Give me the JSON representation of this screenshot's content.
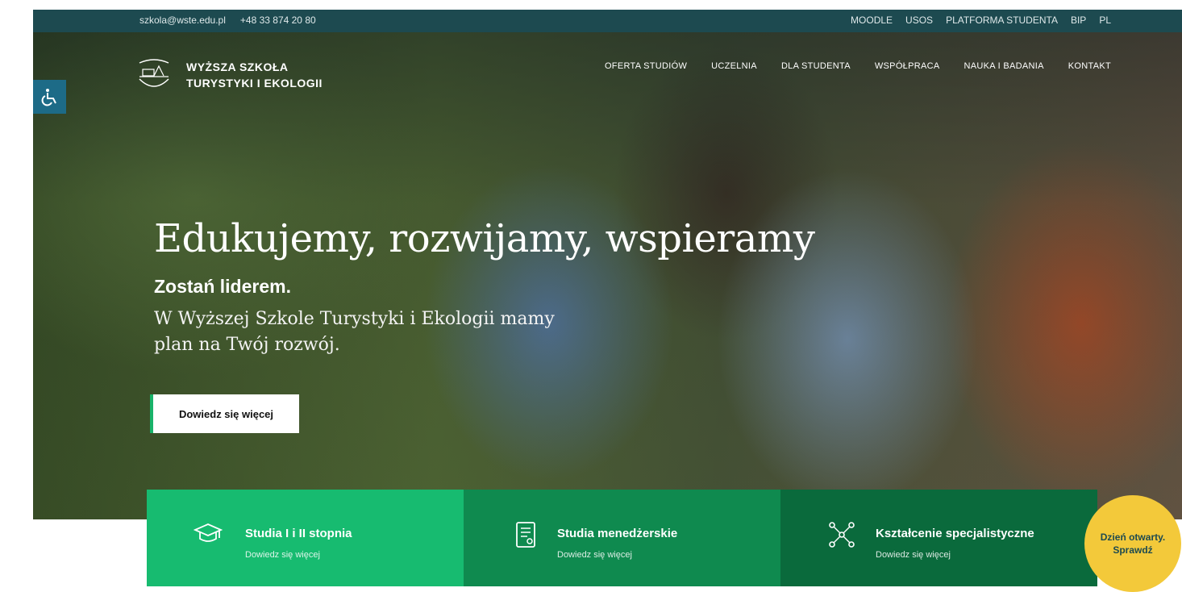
{
  "topbar": {
    "email": "szkola@wste.edu.pl",
    "phone": "+48 33 874 20 80",
    "links": [
      "MOODLE",
      "USOS",
      "PLATFORMA STUDENTA",
      "BIP",
      "PL"
    ]
  },
  "logo": {
    "line1": "WYŻSZA SZKOŁA",
    "line2": "TURYSTYKI I EKOLOGII"
  },
  "nav": [
    "OFERTA STUDIÓW",
    "UCZELNIA",
    "DLA STUDENTA",
    "WSPÓŁPRACA",
    "NAUKA I BADANIA",
    "KONTAKT"
  ],
  "hero": {
    "headline": "Edukujemy, rozwijamy, wspieramy",
    "subhead": "Zostań liderem.",
    "lead_line1": "W Wyższej Szkole Turystyki i Ekologii mamy",
    "lead_line2": "plan na Twój rozwój.",
    "cta": "Dowiedz się więcej"
  },
  "cards": [
    {
      "title": "Studia I i II stopnia",
      "sub": "Dowiedz się więcej",
      "icon": "graduation-cap-icon"
    },
    {
      "title": "Studia menedżerskie",
      "sub": "Dowiedz się więcej",
      "icon": "certificate-icon"
    },
    {
      "title": "Kształcenie specjalistyczne",
      "sub": "Dowiedz się więcej",
      "icon": "network-icon"
    }
  ],
  "openday": {
    "line1": "Dzień otwarty.",
    "line2": "Sprawdź"
  },
  "colors": {
    "topbar": "#1d4a50",
    "card1": "#17bb70",
    "card2": "#0f8a4f",
    "card3": "#0a6a3c",
    "openday": "#f3c93a"
  }
}
